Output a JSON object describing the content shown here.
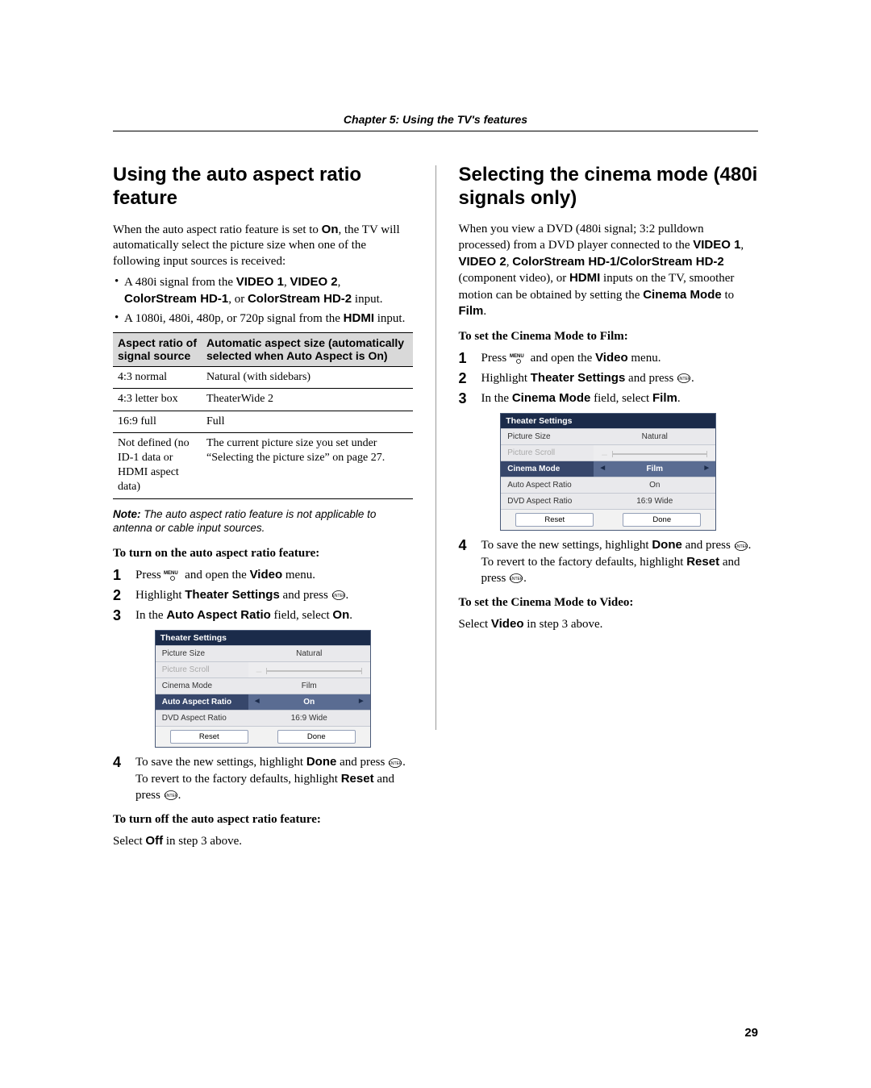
{
  "chapter_header": "Chapter 5: Using the TV's features",
  "page_number": "29",
  "left": {
    "title": "Using the auto aspect ratio feature",
    "intro": "When the auto aspect ratio feature is set to ",
    "intro_bold": "On",
    "intro2": ", the TV will automatically select the picture size when one of the following input sources is received:",
    "bullet1_a": "A 480i signal from the ",
    "bullet1_inputs": [
      "VIDEO 1",
      "VIDEO 2",
      "ColorStream HD-1",
      "ColorStream HD-2"
    ],
    "bullet1_or": ", or ",
    "bullet1_end": " input.",
    "bullet2_a": "A 1080i, 480i, 480p, or 720p signal from the ",
    "bullet2_hdmi": "HDMI",
    "bullet2_end": " input.",
    "table": {
      "head1": "Aspect ratio of signal source",
      "head2": "Automatic aspect size (automatically selected when Auto Aspect is On)",
      "rows": [
        {
          "c1": "4:3 normal",
          "c2": "Natural (with sidebars)"
        },
        {
          "c1": "4:3 letter box",
          "c2": "TheaterWide 2"
        },
        {
          "c1": "16:9 full",
          "c2": "Full"
        },
        {
          "c1": "Not defined (no ID-1 data or HDMI aspect data)",
          "c2": "The current picture size you set under “Selecting the picture size” on page 27."
        }
      ]
    },
    "note_label": "Note:",
    "note_text": " The auto aspect ratio feature is not applicable to antenna or cable input sources.",
    "sub_on": "To turn on the auto aspect ratio feature:",
    "steps_on": [
      {
        "a": "Press ",
        "b": " and open the ",
        "c": "Video",
        "d": " menu."
      },
      {
        "a": "Highlight ",
        "c": "Theater Settings",
        "d": " and press ",
        "post_icon": "."
      },
      {
        "a": "In the ",
        "c": "Auto Aspect Ratio",
        "d": " field, select ",
        "e": "On",
        "f": "."
      }
    ],
    "osd": {
      "title": "Theater Settings",
      "rows": [
        {
          "label": "Picture Size",
          "value": "Natural"
        },
        {
          "label": "Picture Scroll",
          "slider": true,
          "disabled": true
        },
        {
          "label": "Cinema Mode",
          "value": "Film"
        },
        {
          "label": "Auto Aspect Ratio",
          "value": "On",
          "hl": true
        },
        {
          "label": "DVD Aspect Ratio",
          "value": "16:9 Wide"
        }
      ],
      "btn_reset": "Reset",
      "btn_done": "Done"
    },
    "step4_a": "To save the new settings, highlight ",
    "step4_done": "Done",
    "step4_b": " and press ",
    "step4_c": ". To revert to the factory defaults, highlight ",
    "step4_reset": "Reset",
    "step4_d": " and press ",
    "step4_e": ".",
    "sub_off": "To turn off the auto aspect ratio feature:",
    "off_text_a": "Select ",
    "off_text_b": "Off",
    "off_text_c": " in step 3 above."
  },
  "right": {
    "title": "Selecting the cinema mode (480i signals only)",
    "intro_a": "When you view a DVD (480i signal; 3:2 pulldown processed) from a DVD player connected to the ",
    "intro_inputs": [
      "VIDEO 1",
      "VIDEO 2",
      "ColorStream HD-1/ColorStream HD-2"
    ],
    "intro_comp": " (component video), or ",
    "intro_hdmi": "HDMI",
    "intro_b": " inputs on the TV, smoother motion can be obtained by setting the ",
    "intro_cm": "Cinema Mode",
    "intro_to": " to ",
    "intro_film": "Film",
    "intro_end": ".",
    "sub_film": "To set the Cinema Mode to Film:",
    "steps": [
      {
        "a": "Press ",
        "b": " and open the ",
        "c": "Video",
        "d": " menu."
      },
      {
        "a": "Highlight ",
        "c": "Theater Settings",
        "d": " and press ",
        "post_icon": "."
      },
      {
        "a": "In the ",
        "c": "Cinema Mode",
        "d": " field, select ",
        "e": "Film",
        "f": "."
      }
    ],
    "osd": {
      "title": "Theater Settings",
      "rows": [
        {
          "label": "Picture Size",
          "value": "Natural"
        },
        {
          "label": "Picture Scroll",
          "slider": true,
          "disabled": true
        },
        {
          "label": "Cinema Mode",
          "value": "Film",
          "hl": true
        },
        {
          "label": "Auto Aspect Ratio",
          "value": "On"
        },
        {
          "label": "DVD Aspect Ratio",
          "value": "16:9 Wide"
        }
      ],
      "btn_reset": "Reset",
      "btn_done": "Done"
    },
    "step4_a": "To save the new settings, highlight ",
    "step4_done": "Done",
    "step4_b": " and press ",
    "step4_c": ". To revert to the factory defaults, highlight ",
    "step4_reset": "Reset",
    "step4_d": " and press ",
    "step4_e": ".",
    "sub_video": "To set the Cinema Mode to Video:",
    "video_text_a": "Select ",
    "video_text_b": "Video",
    "video_text_c": " in step 3 above."
  }
}
